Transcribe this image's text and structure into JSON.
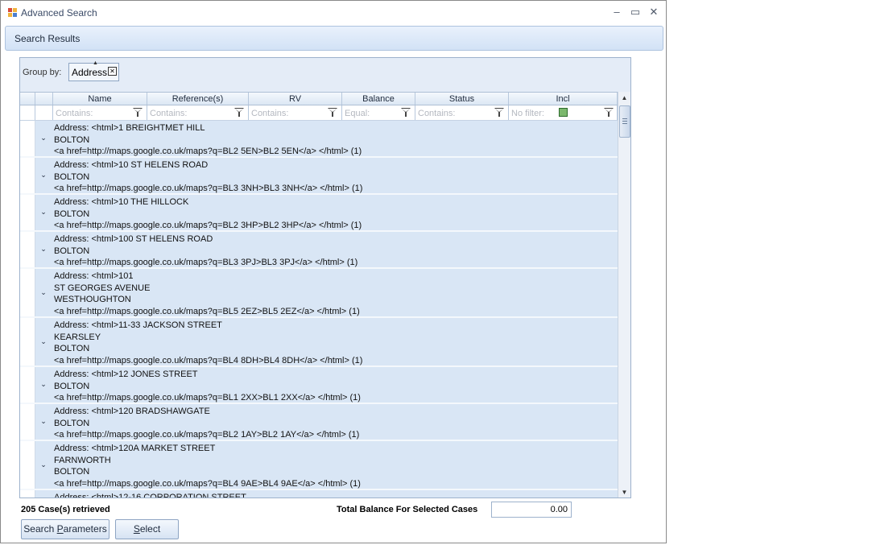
{
  "window": {
    "title": "Advanced Search",
    "minimize_glyph": "–",
    "maximize_glyph": "▭",
    "close_glyph": "✕"
  },
  "panel": {
    "title": "Search Results"
  },
  "group_by": {
    "label": "Group by:",
    "chip_label": "Address",
    "chip_sort_glyph": "▲",
    "chip_remove_glyph": "✕"
  },
  "columns": [
    {
      "label": "Name"
    },
    {
      "label": "Reference(s)"
    },
    {
      "label": "RV"
    },
    {
      "label": "Balance"
    },
    {
      "label": "Status"
    },
    {
      "label": "Incl"
    }
  ],
  "filters": [
    {
      "placeholder": "Contains:"
    },
    {
      "placeholder": "Contains:"
    },
    {
      "placeholder": "Contains:"
    },
    {
      "placeholder": "Equal:"
    },
    {
      "placeholder": "Contains:"
    },
    {
      "placeholder": "No filter:"
    }
  ],
  "group_rows": [
    {
      "chevron": "⌄",
      "text": "Address: <html>1 BREIGHTMET HILL\nBOLTON\n<a href=http://maps.google.co.uk/maps?q=BL2 5EN>BL2 5EN</a> </html> (1)"
    },
    {
      "chevron": "⌄",
      "text": "Address: <html>10 ST HELENS ROAD\nBOLTON\n<a href=http://maps.google.co.uk/maps?q=BL3 3NH>BL3 3NH</a> </html> (1)"
    },
    {
      "chevron": "⌄",
      "text": "Address: <html>10 THE HILLOCK\nBOLTON\n<a href=http://maps.google.co.uk/maps?q=BL2 3HP>BL2 3HP</a> </html> (1)"
    },
    {
      "chevron": "⌄",
      "text": "Address: <html>100 ST HELENS ROAD\nBOLTON\n<a href=http://maps.google.co.uk/maps?q=BL3 3PJ>BL3 3PJ</a> </html> (1)"
    },
    {
      "chevron": "⌄",
      "text": "Address: <html>101\nST GEORGES AVENUE\nWESTHOUGHTON\n<a href=http://maps.google.co.uk/maps?q=BL5 2EZ>BL5 2EZ</a> </html> (1)"
    },
    {
      "chevron": "⌄",
      "text": "Address: <html>11-33 JACKSON STREET\nKEARSLEY\nBOLTON\n<a href=http://maps.google.co.uk/maps?q=BL4 8DH>BL4 8DH</a> </html> (1)"
    },
    {
      "chevron": "⌄",
      "text": "Address: <html>12 JONES STREET\nBOLTON\n<a href=http://maps.google.co.uk/maps?q=BL1 2XX>BL1 2XX</a> </html> (1)"
    },
    {
      "chevron": "⌄",
      "text": "Address: <html>120 BRADSHAWGATE\nBOLTON\n<a href=http://maps.google.co.uk/maps?q=BL2 1AY>BL2 1AY</a> </html> (1)"
    },
    {
      "chevron": "⌄",
      "text": "Address: <html>120A MARKET STREET\nFARNWORTH\nBOLTON\n<a href=http://maps.google.co.uk/maps?q=BL4 9AE>BL4 9AE</a> </html> (1)"
    },
    {
      "chevron": "",
      "text": "Address: <html>12-16 CORPORATION STREET"
    }
  ],
  "scrollbar": {
    "up_glyph": "▲",
    "down_glyph": "▼"
  },
  "footer": {
    "count_text": "205 Case(s) retrieved",
    "total_label": "Total Balance For Selected Cases",
    "total_value": "0.00"
  },
  "buttons": {
    "search_parameters": {
      "before": "Search ",
      "underlined": "P",
      "after": "arameters"
    },
    "select": {
      "before": "",
      "underlined": "S",
      "after": "elect"
    }
  },
  "colors": {
    "accent": "#d9e6f5",
    "incl_checkbox": "#7bb86d"
  }
}
